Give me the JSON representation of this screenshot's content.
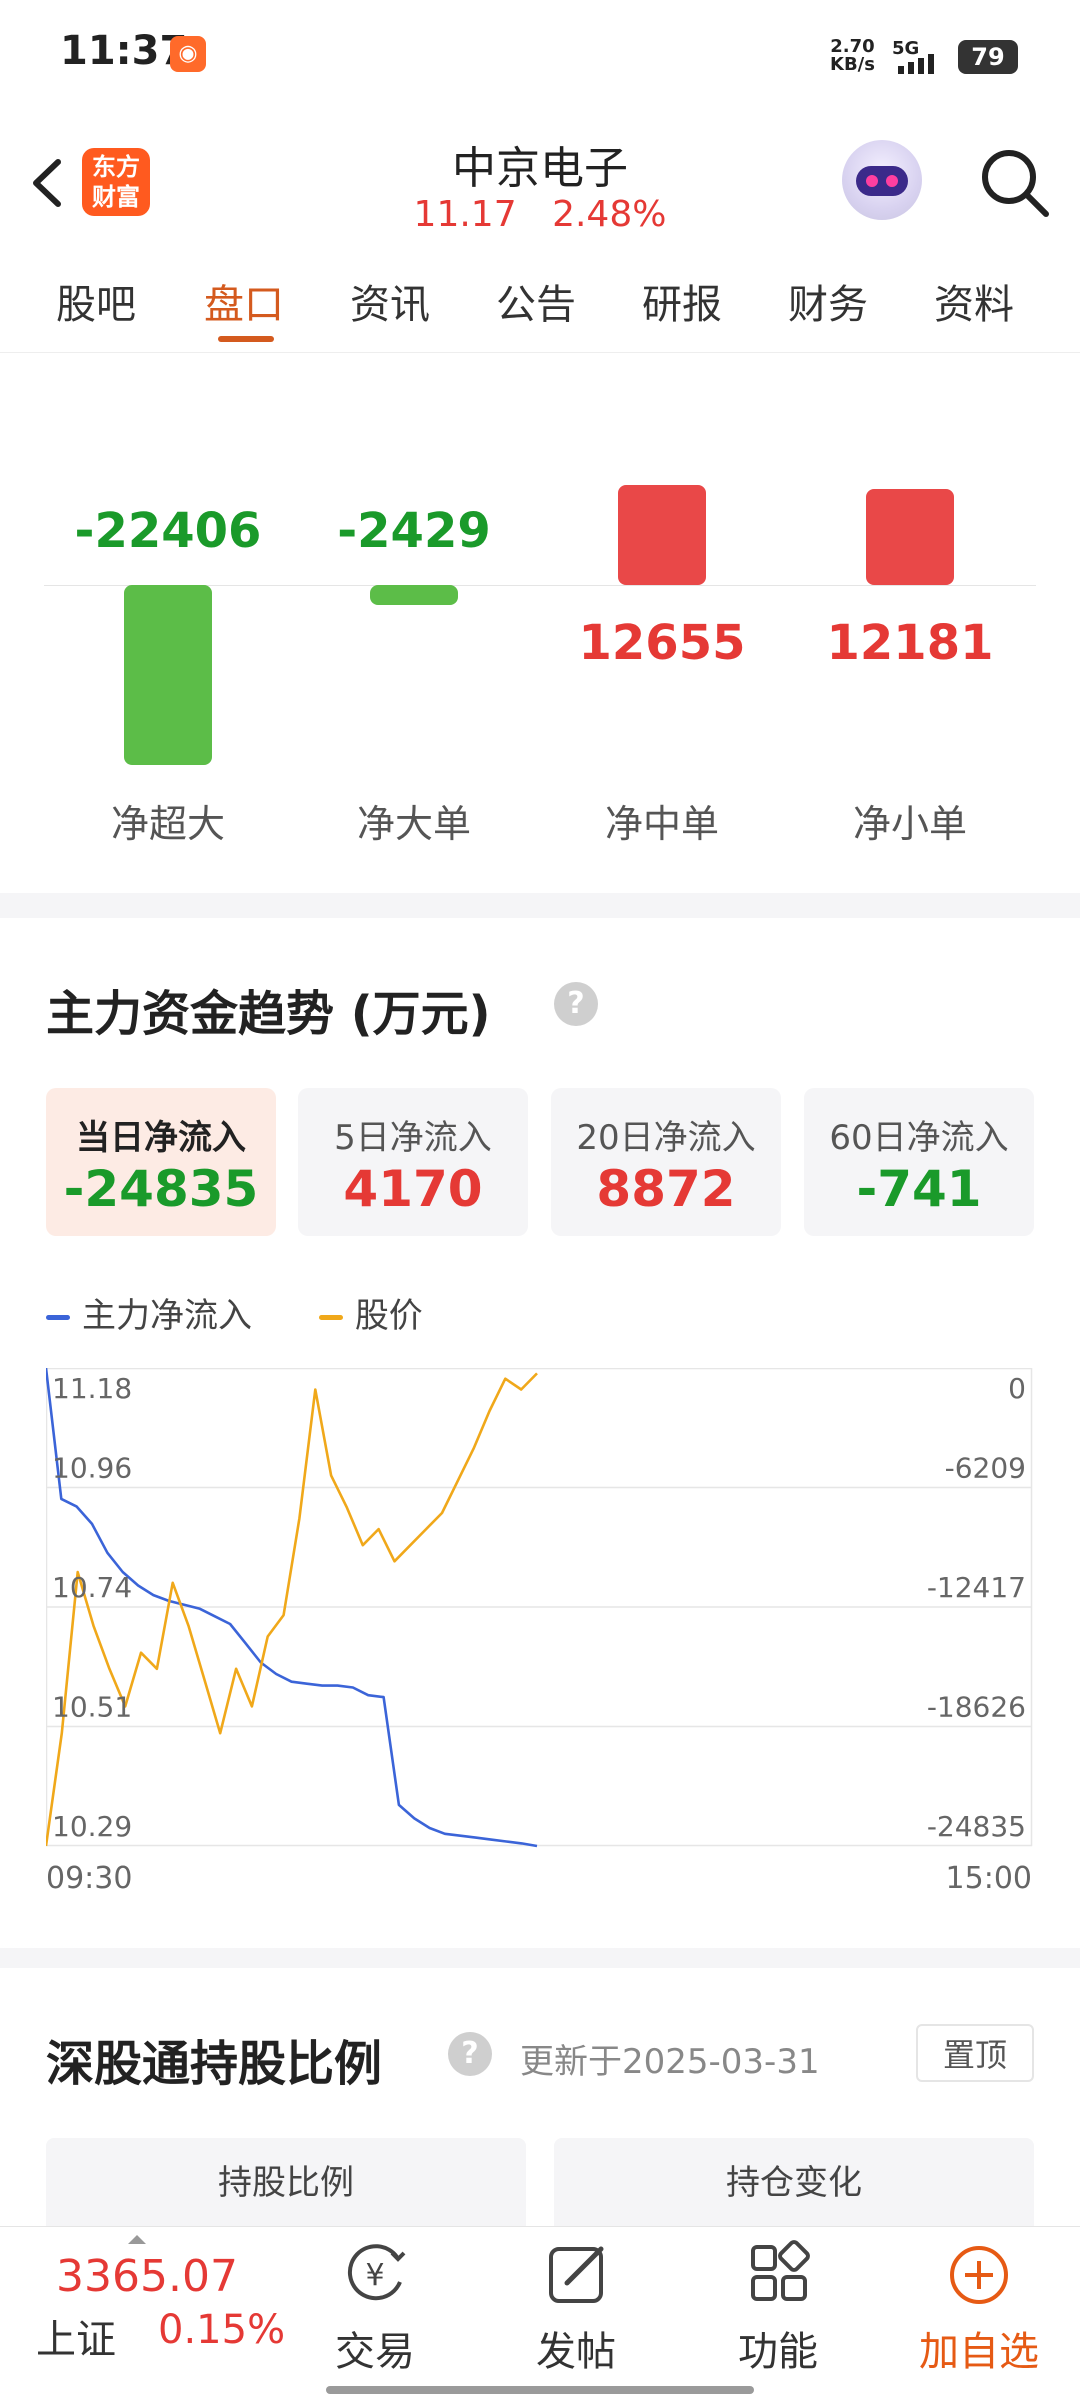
{
  "status_bar": {
    "time": "11:37",
    "net_speed": "2.70",
    "net_speed_unit": "KB/s",
    "net_type": "5G",
    "battery": "79"
  },
  "header": {
    "logo_text": "东方财富",
    "stock_name": "中京电子",
    "price": "11.17",
    "change_pct": "2.48%"
  },
  "tabs": [
    {
      "label": "股吧"
    },
    {
      "label": "盘口"
    },
    {
      "label": "资讯"
    },
    {
      "label": "公告"
    },
    {
      "label": "研报"
    },
    {
      "label": "财务"
    },
    {
      "label": "资料"
    }
  ],
  "active_tab": "盘口",
  "flow_bars": {
    "items": [
      {
        "label": "净超大",
        "value": "-22406"
      },
      {
        "label": "净大单",
        "value": "-2429"
      },
      {
        "label": "净中单",
        "value": "12655"
      },
      {
        "label": "净小单",
        "value": "12181"
      }
    ]
  },
  "trend": {
    "title": "主力资金趋势 (万元)",
    "help": "?",
    "cards": [
      {
        "label": "当日净流入",
        "value": "-24835"
      },
      {
        "label": "5日净流入",
        "value": "4170"
      },
      {
        "label": "20日净流入",
        "value": "8872"
      },
      {
        "label": "60日净流入",
        "value": "-741"
      }
    ]
  },
  "chart_data": {
    "type": "line",
    "series": [
      {
        "name": "主力净流入",
        "color": "#3b64d8",
        "axis": "right",
        "values": [
          0,
          -6800,
          -7200,
          -8100,
          -9600,
          -10600,
          -11300,
          -11800,
          -12100,
          -12300,
          -12500,
          -12900,
          -13300,
          -14300,
          -15300,
          -15900,
          -16300,
          -16400,
          -16500,
          -16500,
          -16600,
          -17000,
          -17100,
          -22700,
          -23400,
          -23900,
          -24200,
          -24300,
          -24400,
          -24500,
          -24600,
          -24700,
          -24835
        ]
      },
      {
        "name": "股价",
        "color": "#f0a81a",
        "axis": "left",
        "values": [
          10.29,
          10.5,
          10.8,
          10.7,
          10.62,
          10.55,
          10.65,
          10.62,
          10.78,
          10.7,
          10.6,
          10.5,
          10.62,
          10.55,
          10.68,
          10.72,
          10.9,
          11.14,
          10.98,
          10.92,
          10.85,
          10.88,
          10.82,
          10.85,
          10.88,
          10.91,
          10.97,
          11.03,
          11.1,
          11.16,
          11.14,
          11.17
        ]
      }
    ],
    "x_ticks": [
      "09:30",
      "15:00"
    ],
    "left_ticks": [
      "11.18",
      "10.96",
      "10.74",
      "10.51",
      "10.29"
    ],
    "right_ticks": [
      "0",
      "-6209",
      "-12417",
      "-18626",
      "-24835"
    ],
    "left_range": [
      10.29,
      11.18
    ],
    "right_range": [
      -24835,
      0
    ],
    "grid": true,
    "legend_position": "top-left"
  },
  "hk_connect": {
    "title": "深股通持股比例",
    "help": "?",
    "updated": "更新于2025-03-31",
    "pin_label": "置顶",
    "tab_ratio": "持股比例",
    "tab_change": "持仓变化"
  },
  "bottom_bar": {
    "index_value": "3365.07",
    "index_name": "上证",
    "index_change": "0.15%",
    "nav": [
      {
        "label": "交易",
        "icon": "yen-cycle-icon"
      },
      {
        "label": "发帖",
        "icon": "edit-icon"
      },
      {
        "label": "功能",
        "icon": "grid-icon"
      },
      {
        "label": "加自选",
        "icon": "plus-circle-icon"
      }
    ]
  }
}
